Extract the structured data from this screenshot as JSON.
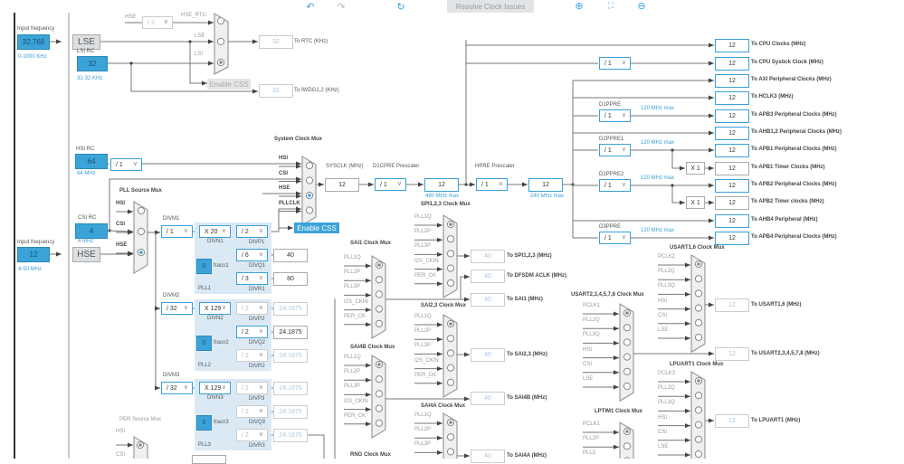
{
  "toolbar": {
    "undo_icon": "undo-icon",
    "redo_icon": "redo-icon",
    "refresh_icon": "refresh-icon",
    "resolve_label": "Resolve Clock Issues",
    "zoom_in_icon": "zoom-in-icon",
    "fit_icon": "fit-screen-icon",
    "zoom_out_icon": "zoom-out-icon"
  },
  "lse": {
    "input_label": "Input frequency",
    "input_value": "32.768",
    "range": "0-1000 KHz",
    "button": "LSE"
  },
  "lsi": {
    "label": "LSI RC",
    "value": "32",
    "range": "31-32 KHz"
  },
  "rtc_mux": {
    "inputs": [
      "HSE",
      "LSE",
      "LSI"
    ],
    "hse_div": "/ 2",
    "hse_rtc": "HSE_RTC",
    "enable_css": "Enable CSS"
  },
  "rtc_out": {
    "value": "32",
    "label": "To RTC (KHz)"
  },
  "iwdg_out": {
    "value": "32",
    "label": "To IWDG1,2 (KHz)"
  },
  "hsi": {
    "label": "HSI RC",
    "value": "64",
    "range": "64 MHz",
    "div": "/ 1"
  },
  "csi": {
    "label": "CSI RC",
    "value": "4",
    "range": "4 MHz"
  },
  "hse": {
    "input_label": "Input frequency",
    "input_value": "12",
    "range": "4-50 MHz",
    "button": "HSE"
  },
  "sys_mux": {
    "title": "System Clock Mux",
    "inputs": [
      "HSI",
      "CSI",
      "HSE",
      "PLLCLK"
    ],
    "selected": 2,
    "enable_css": "Enable CSS"
  },
  "sysclk": {
    "label": "SYSCLK (MHz)",
    "value": "12"
  },
  "d1cpre": {
    "label": "D1CPRE Prescaler",
    "value": "/ 1",
    "out": "12",
    "max": "480 MHz max"
  },
  "hpre": {
    "label": "HPRE Prescaler",
    "value": "/ 1",
    "out": "12",
    "max": "240 MHz max"
  },
  "outputs": [
    {
      "value": "12",
      "label": "To CPU Clocks (MHz)"
    },
    {
      "value": "12",
      "label": "To CPU Systick Clock (MHz)",
      "div": "/ 1"
    },
    {
      "value": "12",
      "label": "To AXI Peripheral Clocks (MHz)"
    },
    {
      "value": "12",
      "label": "To HCLK3 (MHz)"
    },
    {
      "value": "12",
      "label": "To APB3 Peripheral Clocks (MHz)",
      "div": "/ 1",
      "div_label": "D1PPRE",
      "max": "120 MHz max"
    },
    {
      "value": "12",
      "label": "To AHB1,2 Peripheral Clocks (MHz)"
    },
    {
      "value": "12",
      "label": "To APB1 Peripheral Clocks (MHz)",
      "div": "/ 1",
      "div_label": "D2PPRE1",
      "max": "120 MHz max"
    },
    {
      "value": "12",
      "label": "To APB1 Timer Clocks (MHz)",
      "mult": "X 1"
    },
    {
      "value": "12",
      "label": "To APB2 Peripheral Clocks (MHz)",
      "div": "/ 1",
      "div_label": "D2PPRE2",
      "max": "120 MHz max"
    },
    {
      "value": "12",
      "label": "To APB2 Timer clocks (MHz)",
      "mult": "X 1"
    },
    {
      "value": "12",
      "label": "To AHB4 Peripheral (MHz)"
    },
    {
      "value": "12",
      "label": "To APB4 Peripheral Clocks (MHz)",
      "div": "/ 1",
      "div_label": "D3PPRE",
      "max": "120 MHz max"
    }
  ],
  "pll_src": {
    "title": "PLL Source Mux",
    "inputs": [
      "HSI",
      "CSI",
      "HSE"
    ],
    "selected": 2
  },
  "pll": [
    {
      "name": "PLL1",
      "divm_label": "DIVM1",
      "divm": "/ 1",
      "divn": "X 20",
      "divn_label": "DIVN1",
      "fracn": "0",
      "fracn_label": "fracn1",
      "p": {
        "div": "/ 2",
        "label": "DIVP1"
      },
      "q": {
        "div": "/ 6",
        "label": "DIVQ1",
        "out": "40"
      },
      "r": {
        "div": "/ 3",
        "label": "DIVR1",
        "out": "80"
      }
    },
    {
      "name": "PLL2",
      "divm_label": "DIVM2",
      "divm": "/ 32",
      "divn": "X 129",
      "divn_label": "DIVN2",
      "fracn": "0",
      "fracn_label": "fracn2",
      "p": {
        "div": "/ 2",
        "label": "DIVP2",
        "out": "24.1875"
      },
      "q": {
        "div": "/ 2",
        "label": "DIVQ2",
        "out": "24.1875"
      },
      "r": {
        "div": "/ 2",
        "label": "DIVR2",
        "out": "24.1875"
      }
    },
    {
      "name": "PLL3",
      "divm_label": "DIVM3",
      "divm": "/ 32",
      "divn": "X 129",
      "divn_label": "DIVN3",
      "fracn": "0",
      "fracn_label": "fracn3",
      "p": {
        "div": "/ 2",
        "label": "DIVP3",
        "out": "24.1875"
      },
      "q": {
        "div": "/ 2",
        "label": "DIVQ3",
        "out": "24.1875"
      },
      "r": {
        "div": "/ 2",
        "label": "DIVR3",
        "out": "24.1875"
      }
    }
  ],
  "per_mux": {
    "title": "PER Source Mux",
    "inputs": [
      "HSI",
      "CSI"
    ]
  },
  "muxes": {
    "spi123": {
      "title": "SPI1,2,3 Clock Mux",
      "inputs": [
        "PLL1Q",
        "PLL2P",
        "PLL3P",
        "I2S_CKIN",
        "PER_CK"
      ],
      "outputs": [
        {
          "value": "40",
          "label": "To SPI1,2,3 (MHz)"
        },
        {
          "value": "40",
          "label": "To DFSDM ACLK (MHz)"
        }
      ]
    },
    "sai1": {
      "title": "SAI1 Clock Mux",
      "inputs": [
        "PLL1Q",
        "PLL2P",
        "PLL3P",
        "I2S_CKIN",
        "PER_CK"
      ],
      "outputs": [
        {
          "value": "40",
          "label": "To SAI1 (MHz)"
        }
      ]
    },
    "sai23": {
      "title": "SAI2,3 Clock Mux",
      "inputs": [
        "PLL1Q",
        "PLL2P",
        "PLL3P",
        "I2S_CKIN",
        "PER_CK"
      ],
      "outputs": [
        {
          "value": "40",
          "label": "To SAI2,3 (MHz)"
        }
      ]
    },
    "sai4b": {
      "title": "SAI4B Clock Mux",
      "inputs": [
        "PLL1Q",
        "PLL2P",
        "PLL3P",
        "I2S_CKIN",
        "PER_CK"
      ],
      "outputs": [
        {
          "value": "40",
          "label": "To SAI4B (MHz)"
        }
      ]
    },
    "sai4a": {
      "title": "SAI4A Clock Mux",
      "inputs": [
        "PLL1Q",
        "PLL2P",
        "PLL3P"
      ],
      "outputs": [
        {
          "value": "40",
          "label": "To SAI4A (MHz)"
        }
      ]
    },
    "rng": {
      "title": "RNG Clock Mux",
      "inputs": []
    },
    "usart16": {
      "title": "USART1,6 Clock Mux",
      "inputs": [
        "PCLK2",
        "PLL2Q",
        "PLL3Q",
        "HSI",
        "CSI",
        "LSE"
      ],
      "outputs": [
        {
          "value": "12",
          "label": "To USART1,6 (MHz)"
        }
      ]
    },
    "usart2": {
      "title": "USART2,3,4,5,7,8 Clock Mux",
      "inputs": [
        "PCLK1",
        "PLL2Q",
        "PLL3Q",
        "HSI",
        "CSI",
        "LSE"
      ],
      "outputs": [
        {
          "value": "12",
          "label": "To USART2,3,4,5,7,8 (MHz)"
        }
      ]
    },
    "lpuart1": {
      "title": "LPUART1 Clock Mux",
      "inputs": [
        "PCLK3",
        "PLL2Q",
        "PLL3Q",
        "HSI",
        "CSI",
        "LSE"
      ],
      "outputs": [
        {
          "value": "12",
          "label": "To LPUART1 (MHz)"
        }
      ]
    },
    "lptim1": {
      "title": "LPTIM1 Clock Mux",
      "inputs": [
        "PCLK1",
        "PLL2P",
        "PLL3"
      ]
    }
  },
  "colors": {
    "accent": "#3ba3d8",
    "panel": "#dbe9f5",
    "disabled": "#aac8e0"
  }
}
